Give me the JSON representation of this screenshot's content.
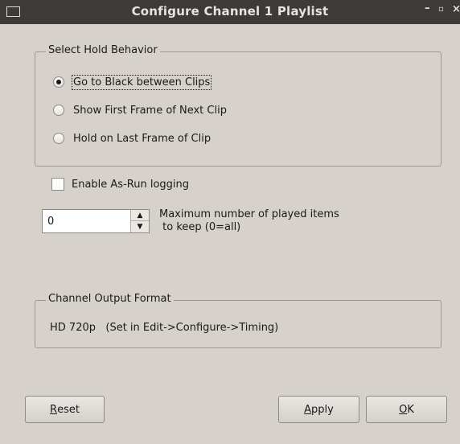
{
  "window": {
    "title": "Configure Channel 1 Playlist",
    "controls": {
      "minimize": "–",
      "maximize": "▫",
      "close": "×"
    }
  },
  "hold_behavior": {
    "group_title": "Select Hold Behavior",
    "options": [
      {
        "label": "Go to Black between Clips",
        "checked": true
      },
      {
        "label": "Show First Frame of Next Clip",
        "checked": false
      },
      {
        "label": "Hold on Last Frame of Clip",
        "checked": false
      }
    ]
  },
  "as_run": {
    "label": "Enable As-Run logging",
    "checked": false
  },
  "max_played": {
    "value": "0",
    "label_line1": "Maximum number of played items",
    "label_line2": " to keep (0=all)"
  },
  "output_format": {
    "group_title": "Channel Output Format",
    "text": "HD 720p   (Set in Edit->Configure->Timing)"
  },
  "buttons": {
    "reset": {
      "mnemonic": "R",
      "rest": "eset"
    },
    "apply": {
      "mnemonic": "A",
      "rest": "pply"
    },
    "ok": {
      "mnemonic": "O",
      "rest": "K"
    }
  }
}
